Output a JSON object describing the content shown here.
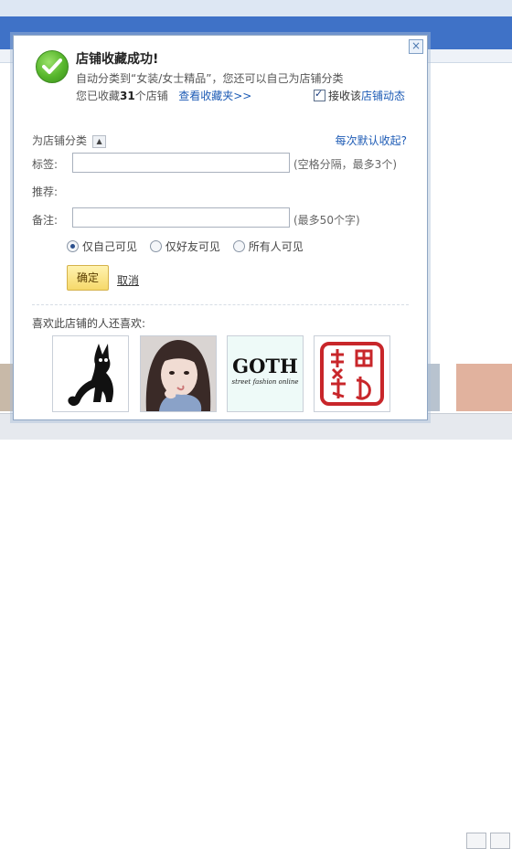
{
  "dialog": {
    "close_glyph": "×",
    "title": "店铺收藏成功!",
    "subline": "自动分类到“女装/女士精品”，您还可以自己为店铺分类",
    "count_prefix": "您已收藏",
    "count_value": "31",
    "count_suffix": "个店铺",
    "view_favorites_link": "查看收藏夹>>",
    "subscribe_checked": true,
    "subscribe_prefix": "接收该",
    "subscribe_link": "店铺动态",
    "category_label": "为店铺分类",
    "category_toggle_glyph": "▲",
    "why_default_link": "每次默认收起?",
    "tag_label": "标签:",
    "tag_value": "",
    "tag_hint": "(空格分隔，最多3个)",
    "recommend_label": "推荐:",
    "note_label": "备注:",
    "note_value": "",
    "note_hint": "(最多50个字)",
    "visibility_options": [
      {
        "label": "仅自己可见",
        "selected": true
      },
      {
        "label": "仅好友可见",
        "selected": false
      },
      {
        "label": "所有人可见",
        "selected": false
      }
    ],
    "ok_button": "确定",
    "cancel_link": "取消",
    "also_like_label": "喜欢此店铺的人还喜欢:",
    "recommended_shops": [
      {
        "icon": "black-cat-logo"
      },
      {
        "icon": "girl-photo"
      },
      {
        "icon": "goth-logo",
        "logo_text": "GOTH",
        "logo_subtext": "street fashion online"
      },
      {
        "icon": "red-seal-logo",
        "seal_text": "錦繡坊"
      }
    ]
  },
  "colors": {
    "accent_blue": "#3f72c7",
    "link_blue": "#1d5bb5",
    "success_green": "#56b52b",
    "ok_button_yellow": "#f6d96a",
    "seal_red": "#c8262a"
  }
}
